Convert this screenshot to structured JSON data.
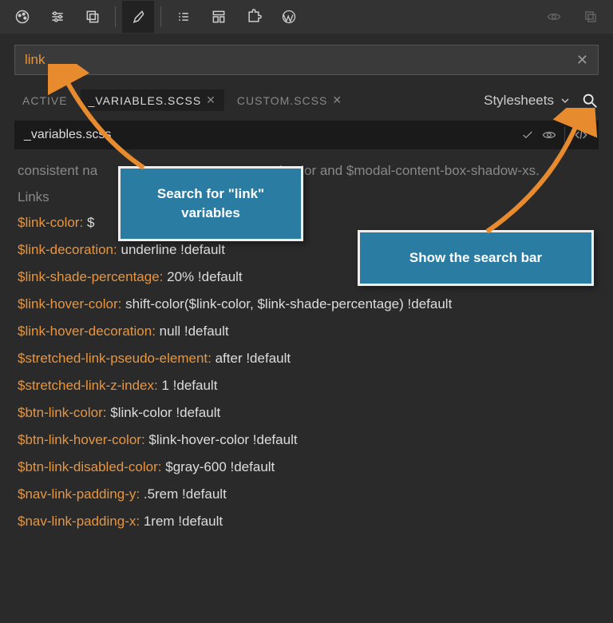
{
  "toolbar": {
    "icons": [
      "palette-icon",
      "sliders-icon",
      "layers-icon",
      "brush-icon",
      "list-icon",
      "layout-icon",
      "puzzle-icon",
      "wordpress-icon"
    ],
    "right_icons": [
      "eye-icon",
      "copy-icon"
    ]
  },
  "search": {
    "value": "link"
  },
  "tabs": {
    "items": [
      {
        "label": "ACTIVE",
        "closable": false,
        "active": false
      },
      {
        "label": "_VARIABLES.SCSS",
        "closable": true,
        "active": true
      },
      {
        "label": "CUSTOM.SCSS",
        "closable": true,
        "active": false
      }
    ],
    "dropdown_label": "Stylesheets"
  },
  "file": {
    "name": "_variables.scss"
  },
  "content": {
    "desc_prefix": "consistent na",
    "desc_suffix": "ed-color and $modal-content-box-shadow-xs.",
    "section": "Links",
    "vars": [
      {
        "name": "$link-color",
        "value": "$"
      },
      {
        "name": "$link-decoration",
        "value": "underline !default"
      },
      {
        "name": "$link-shade-percentage",
        "value": "20% !default"
      },
      {
        "name": "$link-hover-color",
        "value": "shift-color($link-color, $link-shade-percentage) !default"
      },
      {
        "name": "$link-hover-decoration",
        "value": "null !default"
      },
      {
        "name": "$stretched-link-pseudo-element",
        "value": "after !default"
      },
      {
        "name": "$stretched-link-z-index",
        "value": "1 !default"
      },
      {
        "name": "$btn-link-color",
        "value": "$link-color !default"
      },
      {
        "name": "$btn-link-hover-color",
        "value": "$link-hover-color !default"
      },
      {
        "name": "$btn-link-disabled-color",
        "value": "$gray-600 !default"
      },
      {
        "name": "$nav-link-padding-y",
        "value": ".5rem !default"
      },
      {
        "name": "$nav-link-padding-x",
        "value": "1rem !default"
      }
    ]
  },
  "callouts": {
    "c1": "Search for \"link\" variables",
    "c2": "Show the search bar"
  }
}
